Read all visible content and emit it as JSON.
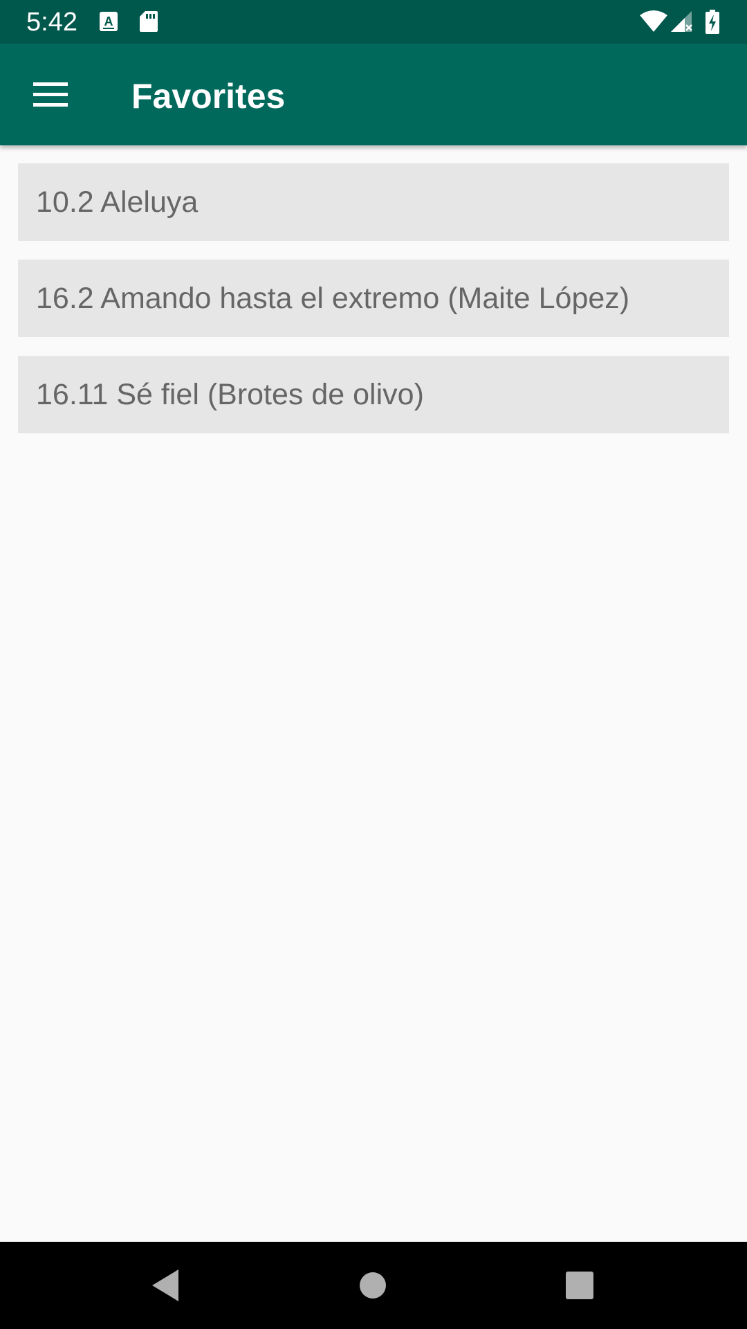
{
  "status_bar": {
    "time": "5:42",
    "left_icons": [
      "keyboard-a-icon",
      "sd-card-icon"
    ],
    "right_icons": [
      "wifi-icon",
      "cell-signal-icon",
      "battery-charging-icon"
    ]
  },
  "app_bar": {
    "menu_icon": "hamburger-menu-icon",
    "title": "Favorites"
  },
  "favorites": {
    "items": [
      {
        "label": "10.2 Aleluya"
      },
      {
        "label": "16.2 Amando hasta el extremo (Maite López)"
      },
      {
        "label": "16.11 Sé fiel (Brotes de olivo)"
      }
    ]
  },
  "nav_bar": {
    "buttons": [
      "back-icon",
      "home-icon",
      "recents-icon"
    ]
  },
  "colors": {
    "status_bar": "#00574b",
    "app_bar": "#00695c",
    "background": "#fafafa",
    "list_item": "#e6e6e6",
    "list_text": "#666666"
  }
}
